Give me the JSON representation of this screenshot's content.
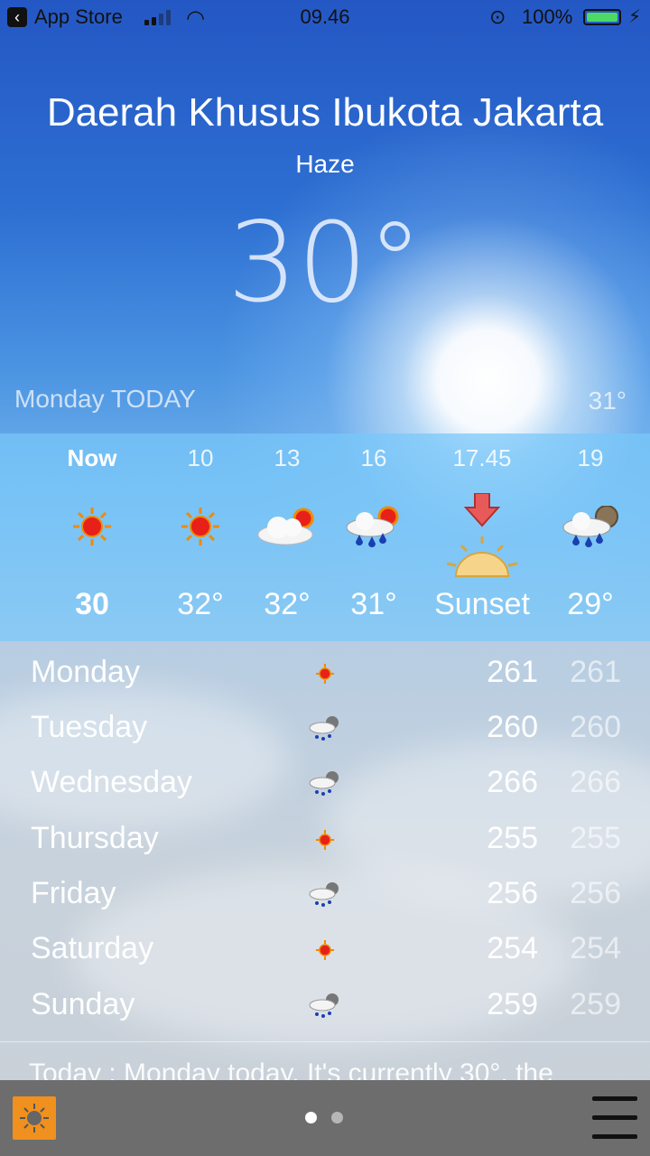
{
  "status_bar": {
    "back_app": "App Store",
    "time": "09.46",
    "battery": "100%",
    "battery_color": "#4cd964"
  },
  "location": {
    "city": "Daerah Khusus Ibukota Jakarta",
    "condition": "Haze",
    "temperature": "30°"
  },
  "today": {
    "label": "Monday TODAY",
    "high": "31°"
  },
  "hourly": [
    {
      "time": "Now",
      "icon": "sun-icon",
      "value": "30"
    },
    {
      "time": "10",
      "icon": "sun-icon",
      "value": "32°"
    },
    {
      "time": "13",
      "icon": "cloud-sun-icon",
      "value": "32°"
    },
    {
      "time": "16",
      "icon": "rain-sun-icon",
      "value": "31°"
    },
    {
      "time": "17.45",
      "icon": "sunset-icon",
      "value": "Sunset"
    },
    {
      "time": "19",
      "icon": "rain-moon-icon",
      "value": "29°"
    }
  ],
  "daily": [
    {
      "day": "Monday",
      "icon": "sun-icon",
      "v1": "261",
      "v2": "261"
    },
    {
      "day": "Tuesday",
      "icon": "storm-icon",
      "v1": "260",
      "v2": "260"
    },
    {
      "day": "Wednesday",
      "icon": "storm-icon",
      "v1": "266",
      "v2": "266"
    },
    {
      "day": "Thursday",
      "icon": "sun-icon",
      "v1": "255",
      "v2": "255"
    },
    {
      "day": "Friday",
      "icon": "storm-icon",
      "v1": "256",
      "v2": "256"
    },
    {
      "day": "Saturday",
      "icon": "sun-icon",
      "v1": "254",
      "v2": "254"
    },
    {
      "day": "Sunday",
      "icon": "storm-icon",
      "v1": "259",
      "v2": "259"
    }
  ],
  "summary": "Today : Monday today. It's currently 30°, the",
  "tab_bar": {
    "page_count": 2,
    "active_page": 1,
    "accent": "#f0901e"
  }
}
